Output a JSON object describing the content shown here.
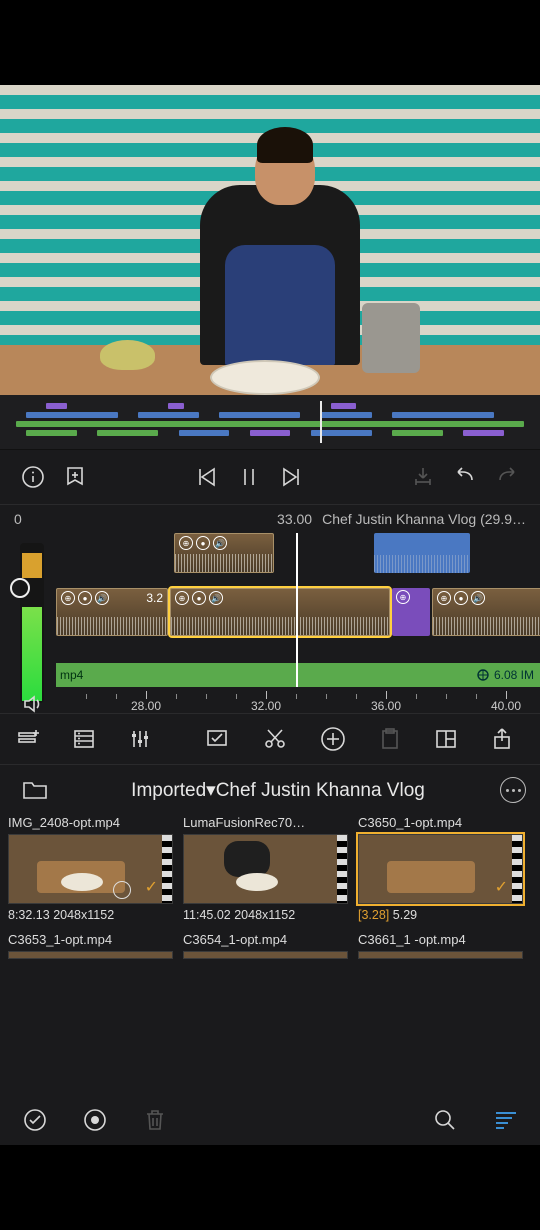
{
  "timeline": {
    "start_label": "0",
    "current_time": "33.00",
    "project_label": "Chef Justin Khanna Vlog (29.9…",
    "ruler": [
      "28.00",
      "32.00",
      "36.00",
      "40.00"
    ],
    "audio_clip_ext": "mp4",
    "audio_clip_size": "6.08 IM",
    "clip_speed": "3.2"
  },
  "library": {
    "breadcrumb": "Imported▾Chef Justin Khanna Vlog",
    "clips": [
      {
        "file": "IMG_2408-opt.mp4",
        "meta_a": "8:32.13",
        "meta_b": "2048x1152"
      },
      {
        "file": "LumaFusionRec70…",
        "meta_a": "11:45.02",
        "meta_b": "2048x1152"
      },
      {
        "file": "C3650_1-opt.mp4",
        "meta_a": "[3.28]",
        "meta_b": "5.29"
      },
      {
        "file": "C3653_1-opt.mp4",
        "meta_a": "",
        "meta_b": ""
      },
      {
        "file": "C3654_1-opt.mp4",
        "meta_a": "",
        "meta_b": ""
      },
      {
        "file": "C3661_1 -opt.mp4",
        "meta_a": "",
        "meta_b": ""
      }
    ]
  }
}
